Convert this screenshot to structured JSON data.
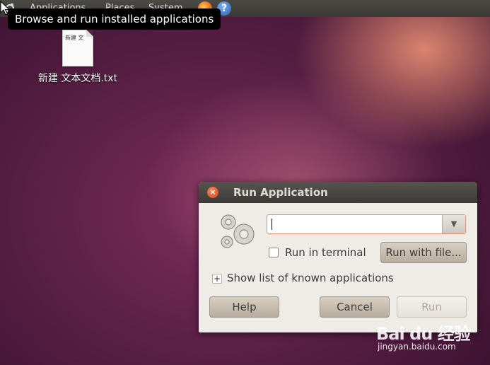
{
  "panel": {
    "menus": [
      "Applications",
      "Places",
      "System"
    ]
  },
  "tooltip": {
    "text": "Browse and run installed applications"
  },
  "desktop": {
    "file_preview": "新建 文",
    "file_label": "新建 文本文档.txt"
  },
  "dialog": {
    "title": "Run Application",
    "command_value": "",
    "run_in_terminal_label": "Run in terminal",
    "run_in_terminal_checked": false,
    "run_with_file_label": "Run with file...",
    "show_list_label": "Show list of known applications",
    "help_label": "Help",
    "cancel_label": "Cancel",
    "run_label": "Run",
    "run_enabled": false
  },
  "watermark": {
    "logo": "Bai du 经验",
    "url": "jingyan.baidu.com"
  },
  "colors": {
    "panel_bg": "#3a3935",
    "dialog_bg": "#efebe7",
    "titlebar_bg": "#3d3b37",
    "close_button": "#e05a2a",
    "button_bg": "#c6bcae",
    "input_focus_border": "#e29070",
    "desktop_bg": "#5a1f48"
  },
  "icons": [
    "ubuntu-logo-icon",
    "firefox-icon",
    "help-icon",
    "close-icon",
    "gears-icon",
    "dropdown-arrow-icon",
    "text-file-icon",
    "mouse-cursor-icon"
  ]
}
